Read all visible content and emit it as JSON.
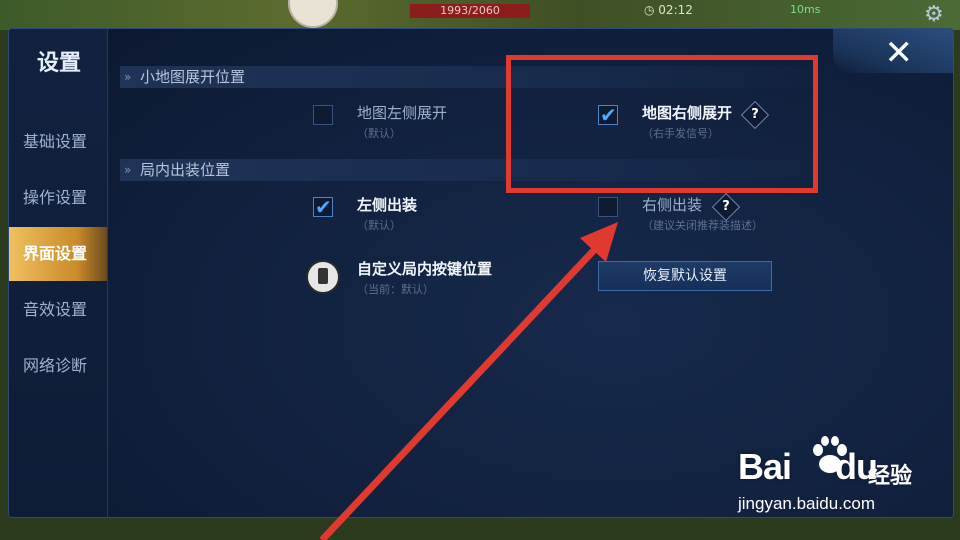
{
  "hud": {
    "hp_text": "1993/2060",
    "timer": "02:12",
    "fps": "10ms"
  },
  "settings": {
    "title": "设置",
    "close_label": "✕",
    "nav": [
      {
        "label": "基础设置",
        "active": false
      },
      {
        "label": "操作设置",
        "active": false
      },
      {
        "label": "界面设置",
        "active": true
      },
      {
        "label": "音效设置",
        "active": false
      },
      {
        "label": "网络诊断",
        "active": false
      }
    ],
    "minimap_section": {
      "header": "小地图展开位置",
      "left_option": {
        "label": "地图左侧展开",
        "sub": "（默认）",
        "checked": false
      },
      "right_option": {
        "label": "地图右侧展开",
        "sub": "（右手发信号）",
        "checked": true
      }
    },
    "equip_section": {
      "header": "局内出装位置",
      "left_option": {
        "label": "左侧出装",
        "sub": "（默认）",
        "checked": true
      },
      "right_option": {
        "label": "右侧出装",
        "sub": "（建议关闭推荐装描述）",
        "checked": false
      }
    },
    "custom_keys": {
      "label": "自定义局内按键位置",
      "sub": "（当前：默认）"
    },
    "reset_button": "恢复默认设置",
    "help_glyph": "?"
  },
  "watermark": {
    "logo_left": "Bai",
    "logo_right": "du",
    "brand_cn": "经验",
    "url": "jingyan.baidu.com"
  },
  "colors": {
    "accent_gold": "#f0c060",
    "check_blue": "#4fa8ff",
    "annotation_red": "#e03a30"
  }
}
